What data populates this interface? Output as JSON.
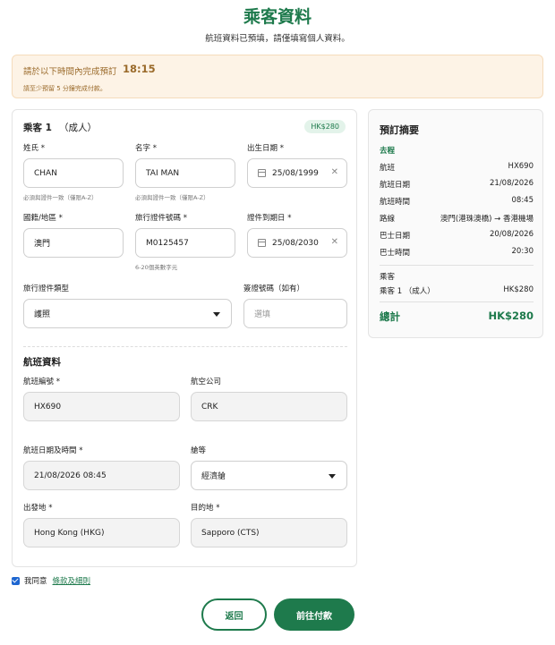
{
  "header": {
    "title": "乘客資料",
    "subtitle": "航班資料已預填，請僅填寫個人資料。"
  },
  "timer": {
    "label": "請於以下時間內完成預訂",
    "value": "18:15",
    "note": "請至少預留 5 分鐘完成付款。"
  },
  "passenger": {
    "title": "乘客 1",
    "type": "（成人）",
    "price": "HK$280",
    "surname": {
      "label": "姓氏 *",
      "value": "CHAN",
      "hint": "必須與證件一致（僅限A-Z）"
    },
    "given_name": {
      "label": "名字 *",
      "value": "TAI MAN",
      "hint": "必須與證件一致（僅限A-Z）"
    },
    "dob": {
      "label": "出生日期 *",
      "value": "25/08/1999"
    },
    "nationality": {
      "label": "國籍/地區 *",
      "value": "澳門"
    },
    "doc_number": {
      "label": "旅行證件號碼 *",
      "value": "M0125457",
      "hint": "6-20個英數字元"
    },
    "doc_expiry": {
      "label": "證件到期日 *",
      "value": "25/08/2030"
    },
    "doc_type": {
      "label": "旅行證件類型",
      "value": "護照"
    },
    "visa": {
      "label": "簽證號碼（如有）",
      "placeholder": "選填"
    }
  },
  "flight": {
    "section_title": "航班資料",
    "flight_no": {
      "label": "航班編號 *",
      "value": "HX690"
    },
    "airline": {
      "label": "航空公司",
      "value": "CRK"
    },
    "datetime": {
      "label": "航班日期及時間 *",
      "value": "21/08/2026 08:45"
    },
    "cabin": {
      "label": "艙等",
      "value": "經濟艙"
    },
    "origin": {
      "label": "出發地 *",
      "value": "Hong Kong (HKG)"
    },
    "destination": {
      "label": "目的地 *",
      "value": "Sapporo (CTS)"
    }
  },
  "summary": {
    "title": "預訂摘要",
    "section": "去程",
    "rows": [
      {
        "k": "航班",
        "v": "HX690"
      },
      {
        "k": "航班日期",
        "v": "21/08/2026"
      },
      {
        "k": "航班時間",
        "v": "08:45"
      },
      {
        "k": "路線",
        "v": "澳門(港珠澳橋) → 香港機場"
      },
      {
        "k": "巴士日期",
        "v": "20/08/2026"
      },
      {
        "k": "巴士時間",
        "v": "20:30"
      }
    ],
    "pax_header": "乘客",
    "pax_label": "乘客 1 （成人）",
    "pax_price": "HK$280",
    "total_label": "總計",
    "total_value": "HK$280"
  },
  "agreement": {
    "text": "我同意",
    "link": "條款及細則"
  },
  "buttons": {
    "back": "返回",
    "pay": "前往付款"
  },
  "colors": {
    "brand": "#1e7a4c",
    "timer_bg": "#fdf3e6",
    "checkbox": "#1e66d0"
  }
}
